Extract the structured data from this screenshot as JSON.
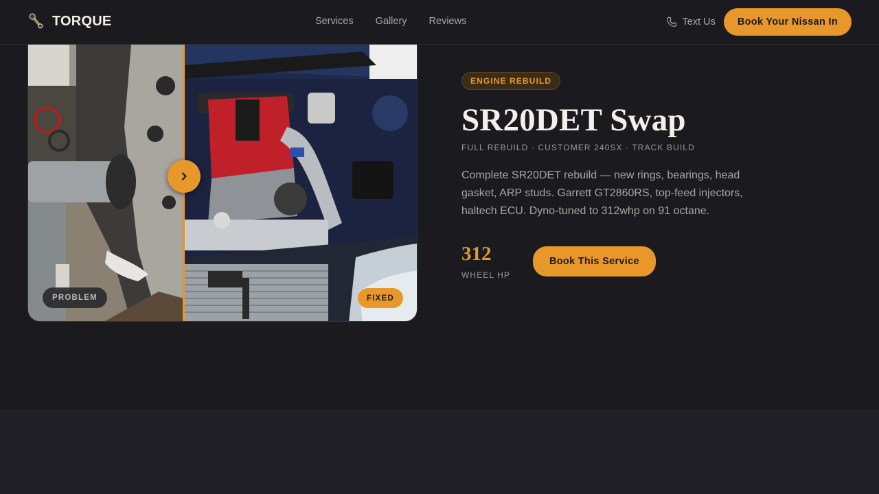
{
  "nav": {
    "brand": "TORQUE",
    "links": [
      "Services",
      "Gallery",
      "Reviews"
    ],
    "text_us": "Text Us",
    "cta": "Book Your Nissan In"
  },
  "compare": {
    "problem_label": "PROBLEM",
    "fixed_label": "FIXED"
  },
  "service": {
    "badge": "ENGINE REBUILD",
    "title": "SR20DET Swap",
    "meta": "FULL REBUILD · CUSTOMER 240SX · TRACK BUILD",
    "description": "Complete SR20DET rebuild — new rings, bearings, head gasket, ARP studs. Garrett GT2860RS, top-feed injectors, haltech ECU. Dyno-tuned to 312whp on 91 octane.",
    "stat_value": "312",
    "stat_label": "WHEEL HP",
    "cta": "Book This Service"
  },
  "colors": {
    "accent": "#e8982a",
    "background": "#1b1a1f",
    "engine_red": "#c0202a",
    "body_blue": "#1e2d55"
  }
}
